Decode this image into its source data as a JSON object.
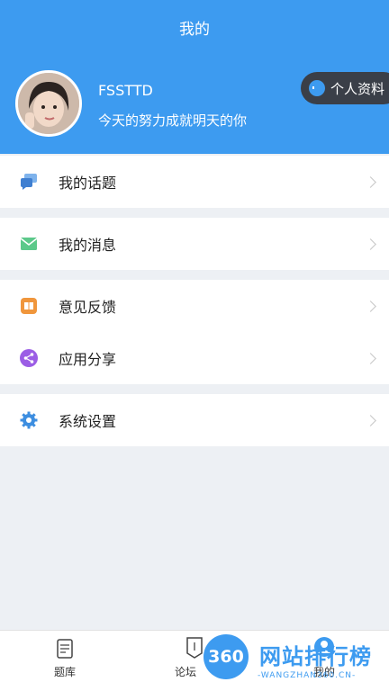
{
  "header": {
    "title": "我的",
    "username": "FSSTTD",
    "signature": "今天的努力成就明天的你",
    "profile_button": "个人资料"
  },
  "menu": [
    {
      "label": "我的话题",
      "icon": "chat-bubbles-icon",
      "color": "#4a90e2"
    },
    {
      "label": "我的消息",
      "icon": "mail-icon",
      "color": "#5cc98a"
    },
    {
      "label": "意见反馈",
      "icon": "feedback-book-icon",
      "color": "#f0963c"
    },
    {
      "label": "应用分享",
      "icon": "share-icon",
      "color": "#9b5de5"
    },
    {
      "label": "系统设置",
      "icon": "gear-icon",
      "color": "#3d8ee0"
    }
  ],
  "tabbar": {
    "tabs": [
      {
        "label": "题库",
        "icon": "question-bank-icon"
      },
      {
        "label": "论坛",
        "icon": "forum-icon"
      },
      {
        "label": "我的",
        "icon": "profile-icon"
      }
    ]
  },
  "watermark": {
    "badge": "360",
    "text": "网站排行榜",
    "sub": "-WANGZHAN360.CN-"
  },
  "colors": {
    "accent": "#3d9bf0",
    "background": "#edf0f4"
  }
}
